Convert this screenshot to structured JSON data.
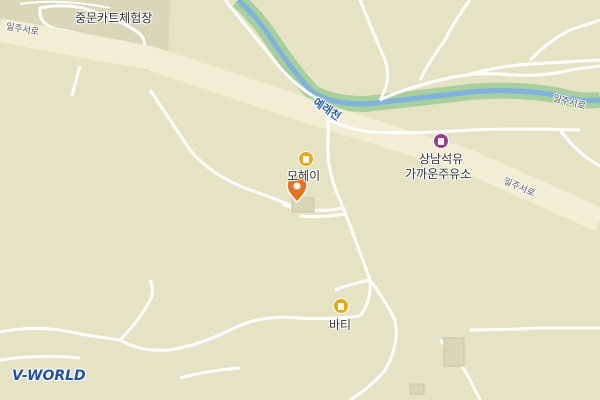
{
  "map": {
    "places": {
      "kart": "중문카트체험장",
      "motel": "모헤이",
      "gas_line1": "상남석유",
      "gas_line2": "가까운주유소",
      "bati": "바티"
    },
    "roads": {
      "ilju_west_1": "일주서로",
      "ilju_west_2": "일주서로",
      "ilju_west_3": "일주서로"
    },
    "river": "예래천",
    "logo": "V-WORLD",
    "icons": {
      "hotel": "hotel-icon",
      "gas_station": "gas-station-icon",
      "location_pin": "location-pin-icon"
    },
    "colors": {
      "land": "#e6e3c4",
      "main_road": "#f3edd3",
      "minor_road": "#ffffff",
      "river": "#7fb2dd",
      "river_bank": "#a6cf9c",
      "hotel": "#e5a911",
      "gas": "#9a3c8b",
      "pin": "#e8711d",
      "logo": "#1d4fb3"
    }
  }
}
